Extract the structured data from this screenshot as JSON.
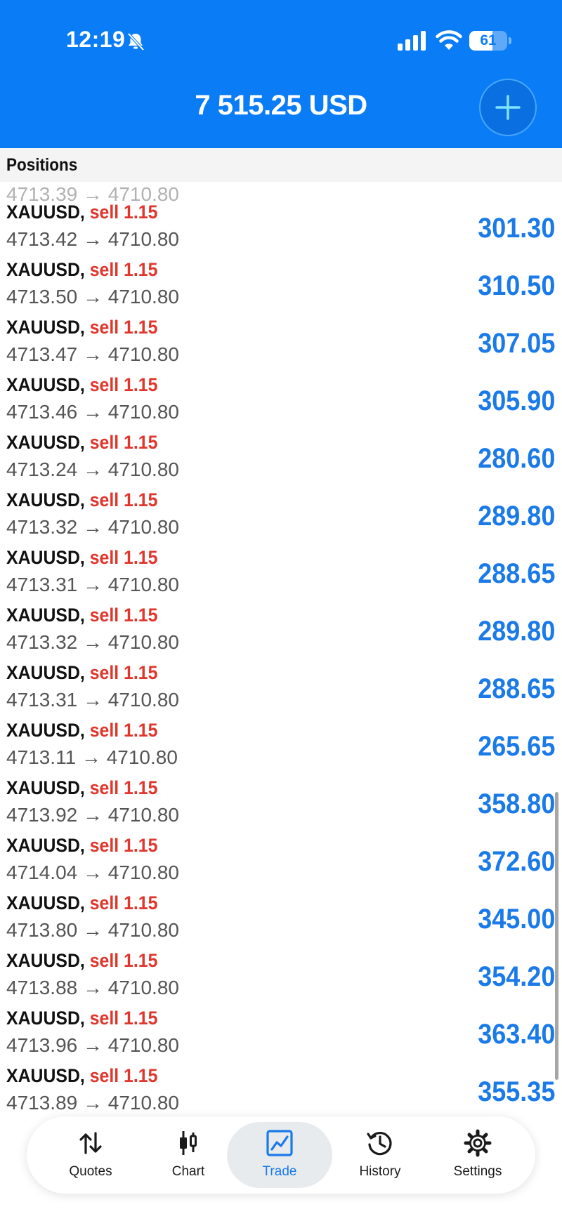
{
  "status_bar": {
    "time": "12:19",
    "battery": "61"
  },
  "header": {
    "balance": "7 515.25 USD"
  },
  "positions": {
    "title": "Positions",
    "partial_row": {
      "prices": "4713.39 → 4710.80"
    },
    "rows": [
      {
        "symbol": "XAUUSD,",
        "side": "sell 1.15",
        "prices": "4713.42 → 4710.80",
        "profit": "301.30"
      },
      {
        "symbol": "XAUUSD,",
        "side": "sell 1.15",
        "prices": "4713.50 → 4710.80",
        "profit": "310.50"
      },
      {
        "symbol": "XAUUSD,",
        "side": "sell 1.15",
        "prices": "4713.47 → 4710.80",
        "profit": "307.05"
      },
      {
        "symbol": "XAUUSD,",
        "side": "sell 1.15",
        "prices": "4713.46 → 4710.80",
        "profit": "305.90"
      },
      {
        "symbol": "XAUUSD,",
        "side": "sell 1.15",
        "prices": "4713.24 → 4710.80",
        "profit": "280.60"
      },
      {
        "symbol": "XAUUSD,",
        "side": "sell 1.15",
        "prices": "4713.32 → 4710.80",
        "profit": "289.80"
      },
      {
        "symbol": "XAUUSD,",
        "side": "sell 1.15",
        "prices": "4713.31 → 4710.80",
        "profit": "288.65"
      },
      {
        "symbol": "XAUUSD,",
        "side": "sell 1.15",
        "prices": "4713.32 → 4710.80",
        "profit": "289.80"
      },
      {
        "symbol": "XAUUSD,",
        "side": "sell 1.15",
        "prices": "4713.31 → 4710.80",
        "profit": "288.65"
      },
      {
        "symbol": "XAUUSD,",
        "side": "sell 1.15",
        "prices": "4713.11 → 4710.80",
        "profit": "265.65"
      },
      {
        "symbol": "XAUUSD,",
        "side": "sell 1.15",
        "prices": "4713.92 → 4710.80",
        "profit": "358.80"
      },
      {
        "symbol": "XAUUSD,",
        "side": "sell 1.15",
        "prices": "4714.04 → 4710.80",
        "profit": "372.60"
      },
      {
        "symbol": "XAUUSD,",
        "side": "sell 1.15",
        "prices": "4713.80 → 4710.80",
        "profit": "345.00"
      },
      {
        "symbol": "XAUUSD,",
        "side": "sell 1.15",
        "prices": "4713.88 → 4710.80",
        "profit": "354.20"
      },
      {
        "symbol": "XAUUSD,",
        "side": "sell 1.15",
        "prices": "4713.96 → 4710.80",
        "profit": "363.40"
      },
      {
        "symbol": "XAUUSD,",
        "side": "sell 1.15",
        "prices": "4713.89 → 4710.80",
        "profit": "355.35"
      }
    ]
  },
  "tabbar": {
    "tabs": [
      {
        "label": "Quotes",
        "icon": "quotes-arrows-icon"
      },
      {
        "label": "Chart",
        "icon": "candlestick-icon"
      },
      {
        "label": "Trade",
        "icon": "trade-chart-icon",
        "active": true
      },
      {
        "label": "History",
        "icon": "history-clock-icon"
      },
      {
        "label": "Settings",
        "icon": "gear-icon"
      }
    ]
  },
  "colors": {
    "header_bg": "#0a7cf5",
    "sell": "#e0362c",
    "profit": "#1a7ae8",
    "active_tab": "#1a7ae8"
  }
}
